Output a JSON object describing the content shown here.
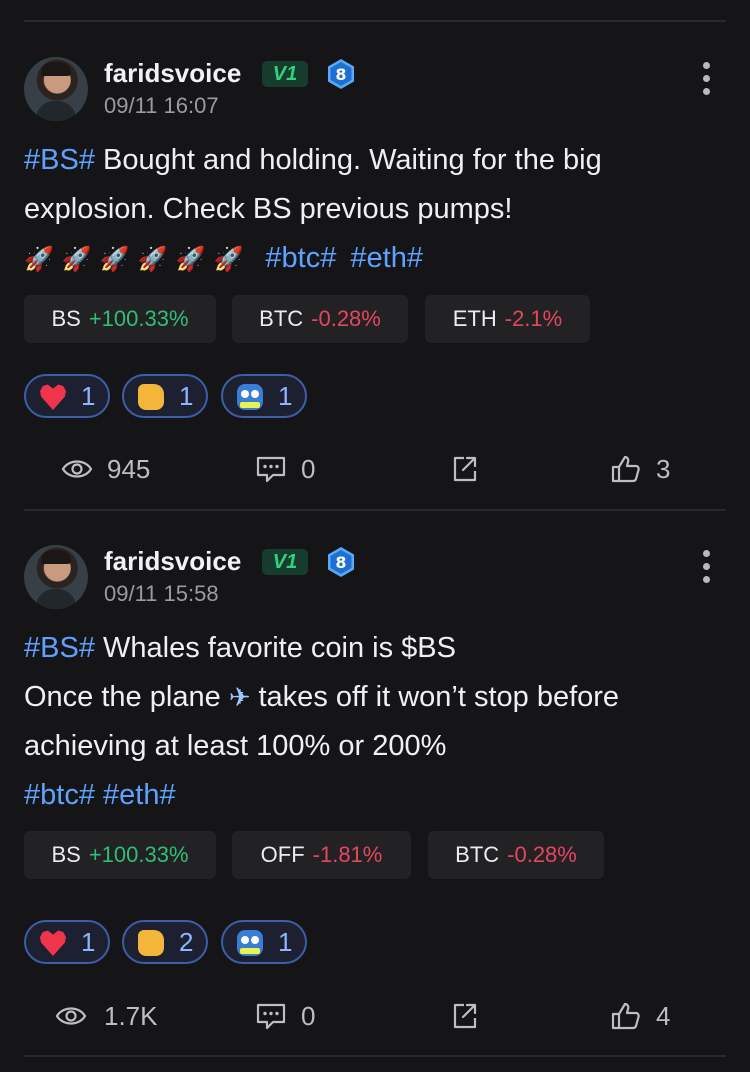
{
  "posts": [
    {
      "username": "faridsvoice",
      "vip_label": "V1",
      "level": "8",
      "timestamp": "09/11 16:07",
      "line1_tag": "#BS#",
      "line1_text": " Bought and holding. Waiting for the big",
      "line2_text": "explosion. Check BS previous pumps!",
      "rockets": [
        "🚀",
        "🚀",
        "🚀",
        "🚀",
        "🚀",
        "🚀"
      ],
      "tag_btc": "#btc#",
      "tag_eth": "#eth#",
      "coins": [
        {
          "symbol": "BS",
          "change": "+100.33%",
          "direction": "up"
        },
        {
          "symbol": "BTC",
          "change": "-0.28%",
          "direction": "down"
        },
        {
          "symbol": "ETH",
          "change": "-2.1%",
          "direction": "down"
        }
      ],
      "reactions": [
        {
          "icon": "heart-icon",
          "count": "1"
        },
        {
          "icon": "thumbs-up-icon",
          "count": "1"
        },
        {
          "icon": "hodl-icon",
          "count": "1"
        }
      ],
      "views": "945",
      "comments": "0",
      "likes": "3"
    },
    {
      "username": "faridsvoice",
      "vip_label": "V1",
      "level": "8",
      "timestamp": "09/11 15:58",
      "line1_tag": "#BS#",
      "line1_text": " Whales favorite coin is $BS",
      "line2_before": "Once the plane",
      "plane": "✈",
      "line2_after": "takes off it won’t stop before",
      "line3_text": "achieving at least 100% or 200%",
      "tag_btc": "#btc#",
      "tag_eth": "#eth#",
      "coins": [
        {
          "symbol": "BS",
          "change": "+100.33%",
          "direction": "up"
        },
        {
          "symbol": "OFF",
          "change": "-1.81%",
          "direction": "down"
        },
        {
          "symbol": "BTC",
          "change": "-0.28%",
          "direction": "down"
        }
      ],
      "reactions": [
        {
          "icon": "heart-icon",
          "count": "1"
        },
        {
          "icon": "thumbs-up-icon",
          "count": "2"
        },
        {
          "icon": "hodl-icon",
          "count": "1"
        }
      ],
      "views": "1.7K",
      "comments": "0",
      "likes": "4"
    }
  ],
  "colors": {
    "background": "#151517",
    "hashtag": "#5ea2ff",
    "positive": "#2fbf74",
    "negative": "#e6465c",
    "vip_badge": "#2fd37e",
    "reaction_border": "#3d5ea8"
  }
}
